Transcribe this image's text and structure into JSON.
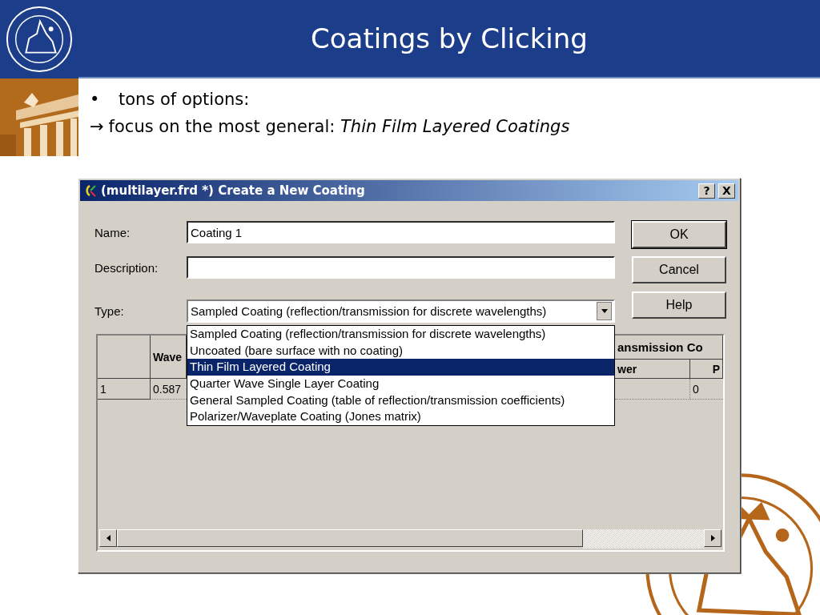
{
  "slide": {
    "title": "Coatings by Clicking",
    "bullets": [
      {
        "kind": "bullet",
        "marker": "•",
        "text": "tons of options:"
      },
      {
        "kind": "arrow",
        "marker": "→",
        "text": "focus on the most general: *Thin Film Layered Coatings*"
      }
    ]
  },
  "dialog": {
    "title": "(multilayer.frd *) Create a New Coating",
    "title_buttons": [
      "?",
      "X"
    ],
    "fields": [
      {
        "label": "Name:",
        "value": "Coating 1"
      },
      {
        "label": "Description:"
      }
    ],
    "type": {
      "label": "Type:",
      "value": "Sampled Coating (reflection/transmission for discrete wavelengths)",
      "expanded": true,
      "options": [
        {
          "text": "Sampled Coating (reflection/transmission for discrete wavelengths)",
          "highlighted": false
        },
        {
          "text": "Uncoated (bare surface with no coating)",
          "highlighted": false
        },
        {
          "text": "Thin Film Layered Coating",
          "highlighted": true
        },
        {
          "text": "Quarter Wave Single Layer Coating",
          "highlighted": false
        },
        {
          "text": "General Sampled Coating (table of reflection/transmission coefficients)",
          "highlighted": false
        },
        {
          "text": "Polarizer/Waveplate Coating (Jones matrix)",
          "highlighted": false
        }
      ]
    },
    "buttons": [
      "OK",
      "Cancel",
      "Help"
    ],
    "table": {
      "wave_header": "Wave",
      "group_header": "ansmission Co",
      "subheaders": [
        "wer",
        "P"
      ],
      "row": {
        "number": "1",
        "wave": "0.587",
        "p": "0"
      }
    }
  }
}
